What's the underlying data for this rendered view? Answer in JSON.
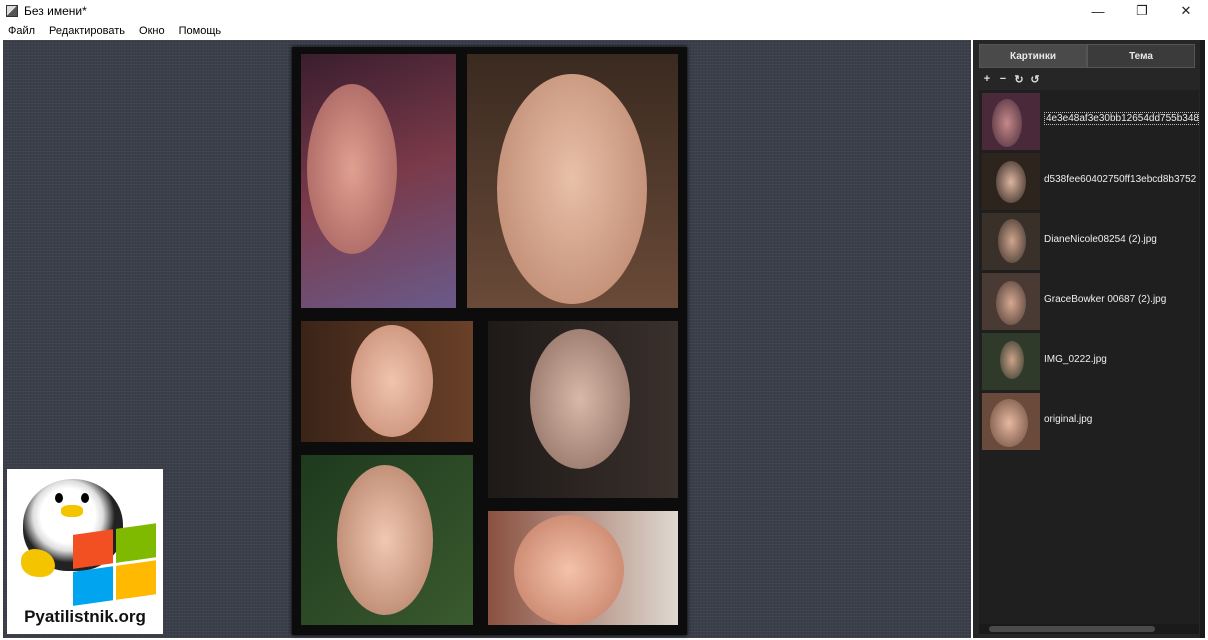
{
  "window": {
    "title": "Без имени*",
    "minimize": "—",
    "maximize": "❐",
    "close": "✕"
  },
  "menu": [
    "Файл",
    "Редактировать",
    "Окно",
    "Помощь"
  ],
  "sidebar": {
    "tabs": [
      "Картинки",
      "Тема"
    ],
    "toolbar": [
      "+",
      "−",
      "↻",
      "↺"
    ],
    "items": [
      {
        "name": "4e3e48af3e30bb12654dd755b348",
        "bg": "#4a2a3a",
        "face": "#c48a8a"
      },
      {
        "name": "d538fee60402750ff13ebcd8b3752",
        "bg": "#2e241e",
        "face": "#dcb4a0"
      },
      {
        "name": "DianeNicole08254 (2).jpg",
        "bg": "#3a302a",
        "face": "#cfa58e"
      },
      {
        "name": "GraceBowker 00687 (2).jpg",
        "bg": "#4a3a34",
        "face": "#d7a890"
      },
      {
        "name": "IMG_0222.jpg",
        "bg": "#2f3a2a",
        "face": "#cfa28a"
      },
      {
        "name": "original.jpg",
        "bg": "#6a4a3a",
        "face": "#e6b8a2"
      }
    ]
  },
  "logo": {
    "text": "Pyatilistnik.org"
  }
}
